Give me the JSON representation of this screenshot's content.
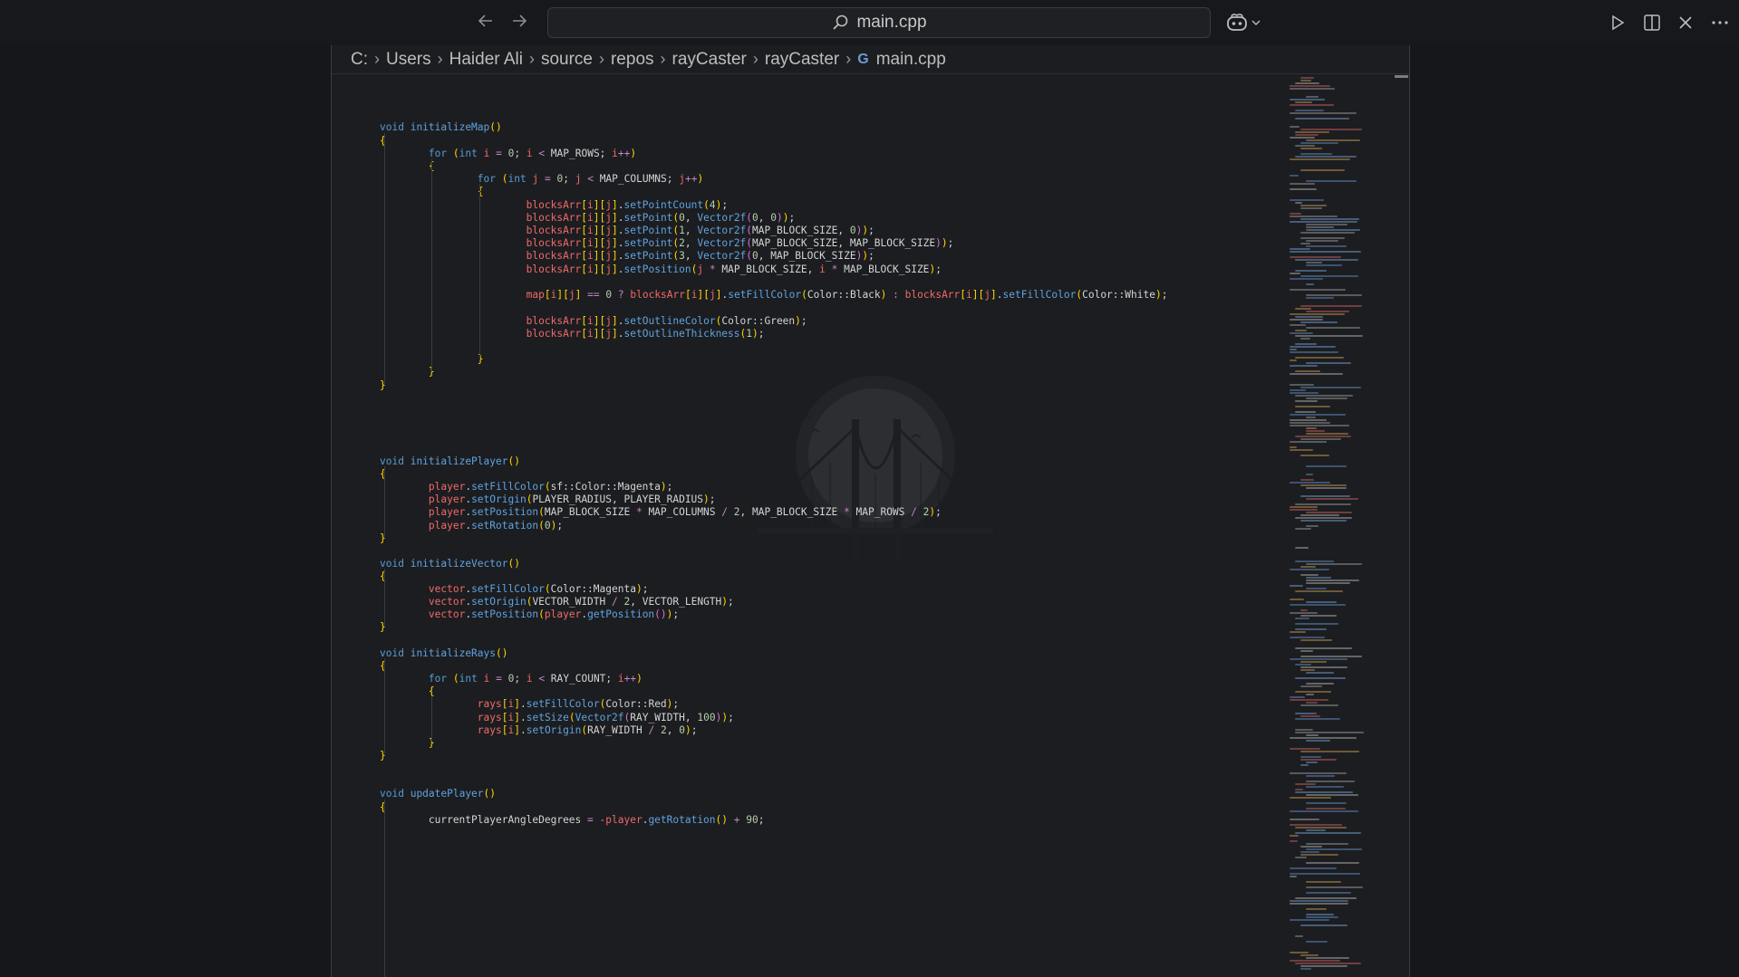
{
  "titlebar": {
    "back_icon": "arrow-left-icon",
    "forward_icon": "arrow-right-icon",
    "search_text": "main.cpp",
    "copilot_icon": "copilot-icon",
    "run_icon": "play-icon",
    "split_icon": "split-editor-icon",
    "close_icon": "close-icon",
    "more_icon": "ellipsis-icon"
  },
  "breadcrumb": {
    "items": [
      "C:",
      "Users",
      "Haider Ali",
      "source",
      "repos",
      "rayCaster",
      "rayCaster"
    ],
    "file_icon": "cpp-file-icon",
    "file": "main.cpp"
  },
  "code": {
    "lines": [
      "void initializeMap()",
      "{",
      "        for (int i = 0; i < MAP_ROWS; i++)",
      "        {",
      "                for (int j = 0; j < MAP_COLUMNS; j++)",
      "                {",
      "                        blocksArr[i][j].setPointCount(4);",
      "                        blocksArr[i][j].setPoint(0, Vector2f(0, 0));",
      "                        blocksArr[i][j].setPoint(1, Vector2f(MAP_BLOCK_SIZE, 0));",
      "                        blocksArr[i][j].setPoint(2, Vector2f(MAP_BLOCK_SIZE, MAP_BLOCK_SIZE));",
      "                        blocksArr[i][j].setPoint(3, Vector2f(0, MAP_BLOCK_SIZE));",
      "                        blocksArr[i][j].setPosition(j * MAP_BLOCK_SIZE, i * MAP_BLOCK_SIZE);",
      "                        map[i][j] == 0 ? blocksArr[i][j].setFillColor(Color::Black) : blocksArr[i][j].setFillColor(Color::White);",
      "                        blocksArr[i][j].setOutlineColor(Color::Green);",
      "                        blocksArr[i][j].setOutlineThickness(1);",
      "                }",
      "        }",
      "}",
      "void initializePlayer()",
      "{",
      "        player.setFillColor(sf::Color::Magenta);",
      "        player.setOrigin(PLAYER_RADIUS, PLAYER_RADIUS);",
      "        player.setPosition(MAP_BLOCK_SIZE * MAP_COLUMNS / 2, MAP_BLOCK_SIZE * MAP_ROWS / 2);",
      "        player.setRotation(0);",
      "}",
      "void initializeVector()",
      "{",
      "        vector.setFillColor(Color::Magenta);",
      "        vector.setOrigin(VECTOR_WIDTH / 2, VECTOR_LENGTH);",
      "        vector.setPosition(player.getPosition());",
      "}",
      "void initializeRays()",
      "{",
      "        for (int i = 0; i < RAY_COUNT; i++)",
      "        {",
      "                rays[i].setFillColor(Color::Red);",
      "                rays[i].setSize(Vector2f(RAY_WIDTH, 100));",
      "                rays[i].setOrigin(RAY_WIDTH / 2, 0);",
      "        }",
      "}",
      "void updatePlayer()",
      "{",
      "        currentPlayerAngleDegrees = -player.getRotation() + 90;"
    ]
  },
  "colors": {
    "keyword": "#569cd6",
    "function": "#5fa3e0",
    "variable": "#f06a6a",
    "bracket_gold": "#ffd700",
    "bracket_purple": "#da70d6",
    "bracket_blue": "#179fff",
    "background": "#1c1d20"
  }
}
